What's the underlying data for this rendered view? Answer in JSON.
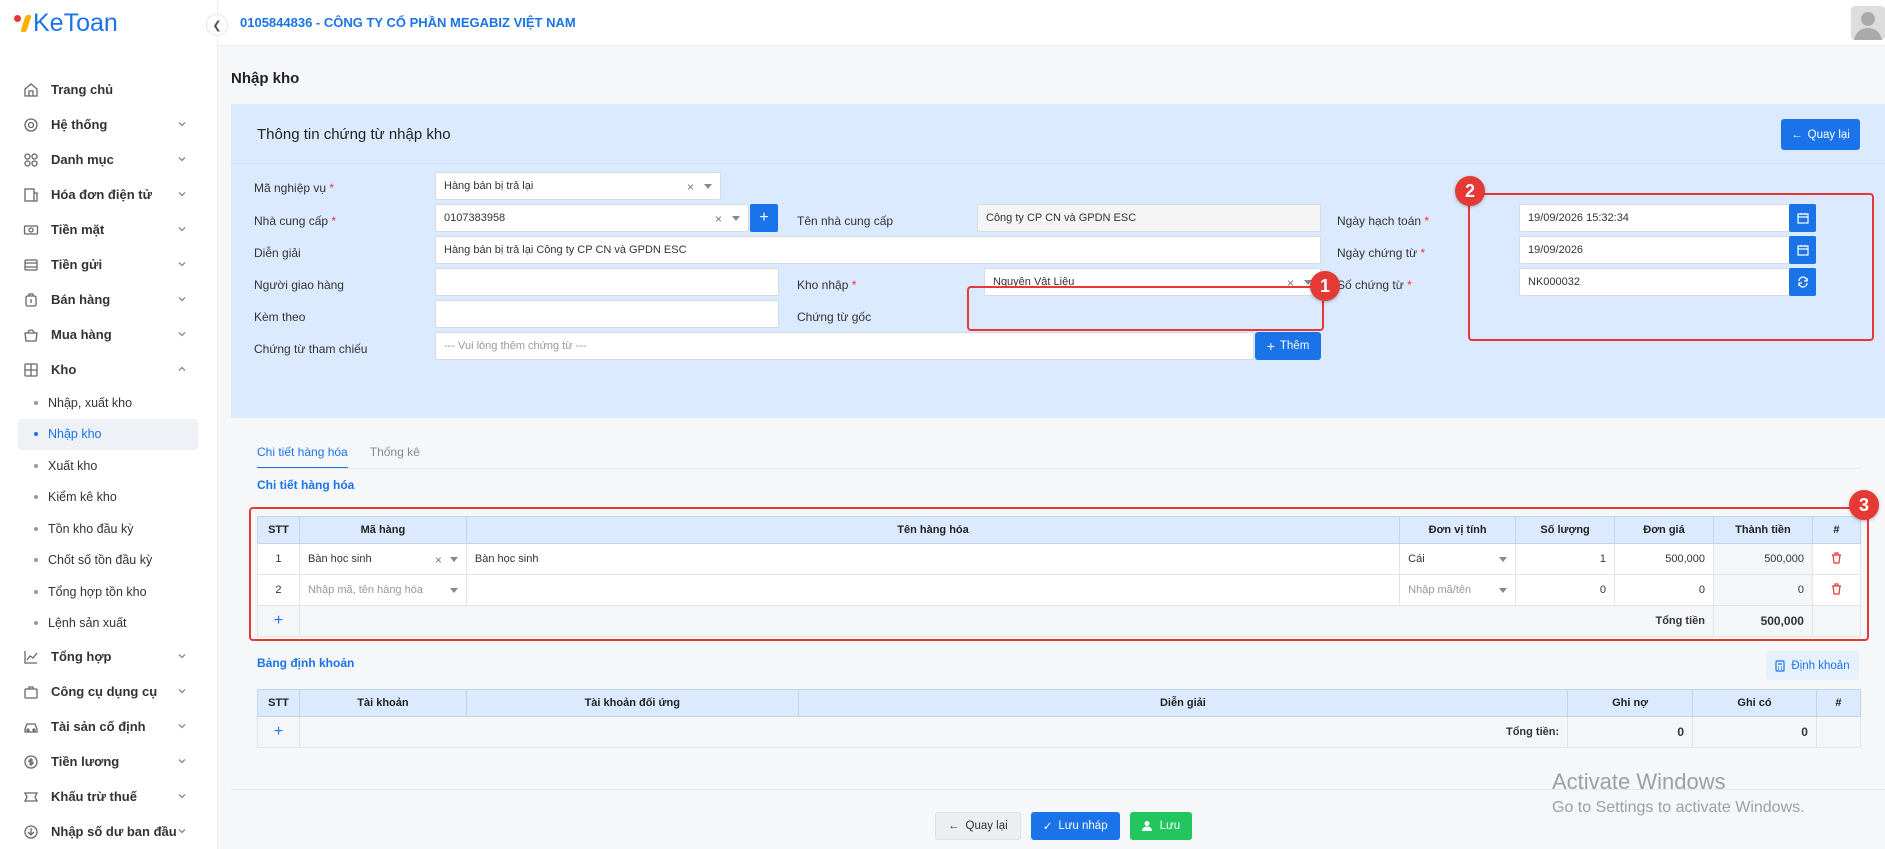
{
  "app": {
    "logo": "KeToan",
    "company": "0105844836 - CÔNG TY CỔ PHẦN MEGABIZ VIỆT NAM"
  },
  "sidebar": {
    "items": [
      {
        "label": "Trang chủ",
        "icon": "home-icon"
      },
      {
        "label": "Hệ thống",
        "icon": "gear-icon"
      },
      {
        "label": "Danh mục",
        "icon": "grid-icon"
      },
      {
        "label": "Hóa đơn điện tử",
        "icon": "invoice-icon"
      },
      {
        "label": "Tiền mặt",
        "icon": "cash-icon"
      },
      {
        "label": "Tiền gửi",
        "icon": "bank-icon"
      },
      {
        "label": "Bán hàng",
        "icon": "sales-icon"
      },
      {
        "label": "Mua hàng",
        "icon": "cart-icon"
      },
      {
        "label": "Kho",
        "icon": "warehouse-icon"
      }
    ],
    "kho_sub": [
      "Nhập, xuất kho",
      "Nhập kho",
      "Xuất kho",
      "Kiểm kê kho",
      "Tồn kho đầu kỳ",
      "Chốt số tồn đầu kỳ",
      "Tổng hợp tồn kho",
      "Lệnh sản xuất"
    ],
    "items_after": [
      {
        "label": "Tổng hợp",
        "icon": "chart-icon"
      },
      {
        "label": "Công cụ dụng cụ",
        "icon": "tools-icon"
      },
      {
        "label": "Tài sản cố định",
        "icon": "car-icon"
      },
      {
        "label": "Tiền lương",
        "icon": "dollar-icon"
      },
      {
        "label": "Khấu trừ thuế",
        "icon": "tax-icon"
      },
      {
        "label": "Nhập số dư ban đầu",
        "icon": "import-icon"
      }
    ]
  },
  "page": {
    "title": "Nhập kho",
    "card_title": "Thông tin chứng từ nhập kho",
    "back_btn": "Quay lại"
  },
  "form": {
    "ma_nghiep_vu_label": "Mã nghiệp vụ",
    "ma_nghiep_vu": "Hàng bán bị trả lại",
    "nha_cung_cap_label": "Nhà cung cấp",
    "nha_cung_cap": "0107383958",
    "ten_ncc_label": "Tên nhà cung cấp",
    "ten_ncc": "Công ty CP CN và GPDN ESC",
    "dien_giai_label": "Diễn giải",
    "dien_giai": "Hàng bán bị trả lại Công ty CP CN và GPDN ESC",
    "nguoi_giao_label": "Người giao hàng",
    "kho_nhap_label": "Kho nhập",
    "kho_nhap": "Nguyên Vật Liệu",
    "kem_theo_label": "Kèm theo",
    "chung_tu_goc_label": "Chứng từ gốc",
    "tham_chieu_label": "Chứng từ tham chiếu",
    "tham_chieu_ph": "--- Vui lòng thêm chứng từ ---",
    "them_btn": "Thêm",
    "ngay_hach_toan_label": "Ngày hạch toán",
    "ngay_hach_toan": "19/09/2026 15:32:34",
    "ngay_chung_tu_label": "Ngày chứng từ",
    "ngay_chung_tu": "19/09/2026",
    "so_chung_tu_label": "Số chứng từ",
    "so_chung_tu": "NK000032"
  },
  "badges": [
    "1",
    "2",
    "3"
  ],
  "tabs": [
    "Chi tiết hàng hóa",
    "Thống kê"
  ],
  "goods": {
    "title": "Chi tiết hàng hóa",
    "headers": [
      "STT",
      "Mã hàng",
      "Tên hàng hóa",
      "Đơn vị tính",
      "Số lượng",
      "Đơn giá",
      "Thành tiền",
      "#"
    ],
    "rows": [
      {
        "stt": "1",
        "ma": "Bàn học sinh",
        "ten": "Bàn học sinh",
        "dvt": "Cái",
        "sl": "1",
        "dg": "500,000",
        "tt": "500,000"
      },
      {
        "stt": "2",
        "ma": "Nhập mã, tên hàng hóa",
        "ten": "",
        "dvt": "Nhập mã/tên",
        "sl": "0",
        "dg": "0",
        "tt": "0"
      }
    ],
    "total_label": "Tổng tiền",
    "total": "500,000"
  },
  "accounts": {
    "title": "Bảng định khoản",
    "btn": "Định khoản",
    "headers": [
      "STT",
      "Tài khoản",
      "Tài khoản đối ứng",
      "Diễn giải",
      "Ghi nợ",
      "Ghi có",
      "#"
    ],
    "total_label": "Tổng tiền:",
    "total_no": "0",
    "total_co": "0"
  },
  "footer": {
    "back": "Quay lại",
    "draft": "Lưu nháp",
    "save": "Lưu"
  },
  "watermark": {
    "line1": "Activate Windows",
    "line2": "Go to Settings to activate Windows."
  },
  "colors": {
    "primary": "#1a73e8",
    "success": "#22c55e",
    "highlight": "#e53935"
  }
}
